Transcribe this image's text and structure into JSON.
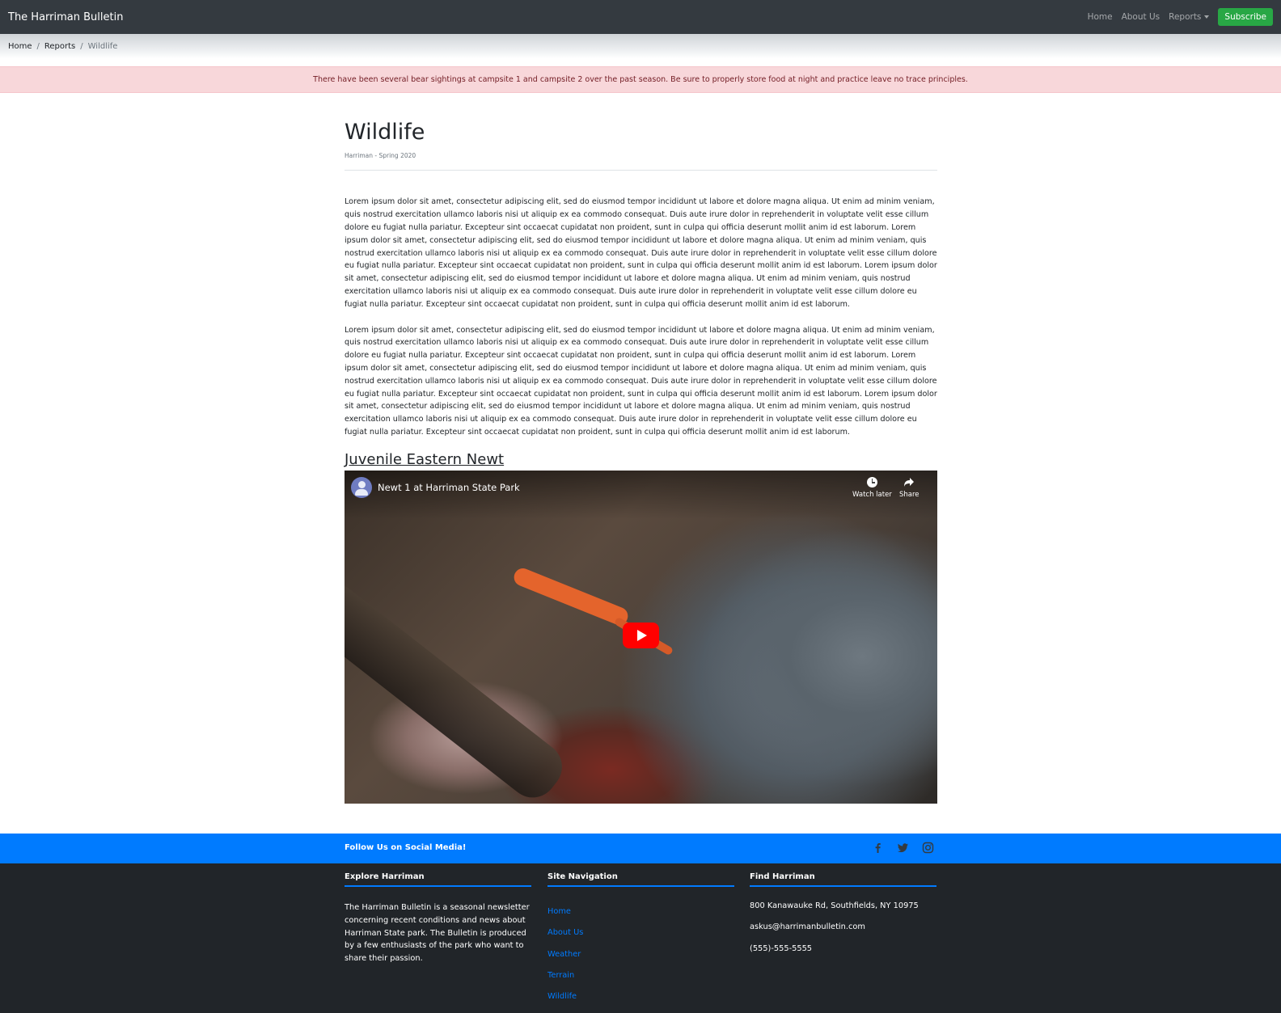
{
  "navbar": {
    "brand": "The Harriman Bulletin",
    "links": {
      "home": "Home",
      "about": "About Us",
      "reports": "Reports"
    },
    "subscribe": "Subscribe"
  },
  "breadcrumb": {
    "items": [
      "Home",
      "Reports"
    ],
    "separator": "/",
    "active": "Wildlife"
  },
  "alert": {
    "text": "There have been several bear sightings at campsite 1 and campsite 2 over the past season. Be sure to properly store food at night and practice leave no trace principles."
  },
  "article": {
    "title": "Wildlife",
    "meta": "Harriman - Spring 2020",
    "paragraphs": [
      "Lorem ipsum dolor sit amet, consectetur adipiscing elit, sed do eiusmod tempor incididunt ut labore et dolore magna aliqua. Ut enim ad minim veniam, quis nostrud exercitation ullamco laboris nisi ut aliquip ex ea commodo consequat. Duis aute irure dolor in reprehenderit in voluptate velit esse cillum dolore eu fugiat nulla pariatur. Excepteur sint occaecat cupidatat non proident, sunt in culpa qui officia deserunt mollit anim id est laborum. Lorem ipsum dolor sit amet, consectetur adipiscing elit, sed do eiusmod tempor incididunt ut labore et dolore magna aliqua. Ut enim ad minim veniam, quis nostrud exercitation ullamco laboris nisi ut aliquip ex ea commodo consequat. Duis aute irure dolor in reprehenderit in voluptate velit esse cillum dolore eu fugiat nulla pariatur. Excepteur sint occaecat cupidatat non proident, sunt in culpa qui officia deserunt mollit anim id est laborum. Lorem ipsum dolor sit amet, consectetur adipiscing elit, sed do eiusmod tempor incididunt ut labore et dolore magna aliqua. Ut enim ad minim veniam, quis nostrud exercitation ullamco laboris nisi ut aliquip ex ea commodo consequat. Duis aute irure dolor in reprehenderit in voluptate velit esse cillum dolore eu fugiat nulla pariatur. Excepteur sint occaecat cupidatat non proident, sunt in culpa qui officia deserunt mollit anim id est laborum.",
      "Lorem ipsum dolor sit amet, consectetur adipiscing elit, sed do eiusmod tempor incididunt ut labore et dolore magna aliqua. Ut enim ad minim veniam, quis nostrud exercitation ullamco laboris nisi ut aliquip ex ea commodo consequat. Duis aute irure dolor in reprehenderit in voluptate velit esse cillum dolore eu fugiat nulla pariatur. Excepteur sint occaecat cupidatat non proident, sunt in culpa qui officia deserunt mollit anim id est laborum. Lorem ipsum dolor sit amet, consectetur adipiscing elit, sed do eiusmod tempor incididunt ut labore et dolore magna aliqua. Ut enim ad minim veniam, quis nostrud exercitation ullamco laboris nisi ut aliquip ex ea commodo consequat. Duis aute irure dolor in reprehenderit in voluptate velit esse cillum dolore eu fugiat nulla pariatur. Excepteur sint occaecat cupidatat non proident, sunt in culpa qui officia deserunt mollit anim id est laborum. Lorem ipsum dolor sit amet, consectetur adipiscing elit, sed do eiusmod tempor incididunt ut labore et dolore magna aliqua. Ut enim ad minim veniam, quis nostrud exercitation ullamco laboris nisi ut aliquip ex ea commodo consequat. Duis aute irure dolor in reprehenderit in voluptate velit esse cillum dolore eu fugiat nulla pariatur. Excepteur sint occaecat cupidatat non proident, sunt in culpa qui officia deserunt mollit anim id est laborum."
    ],
    "section_heading": "Juvenile Eastern Newt",
    "video": {
      "title": "Newt 1 at Harriman State Park",
      "watch_later": "Watch later",
      "share": "Share",
      "play_icon": "play-icon"
    }
  },
  "social": {
    "label": "Follow Us on Social Media!",
    "icons": [
      "facebook-icon",
      "twitter-icon",
      "instagram-icon"
    ]
  },
  "footer": {
    "explore": {
      "heading": "Explore Harriman",
      "text": "The Harriman Bulletin is a seasonal newsletter concerning recent conditions and news about Harriman State park. The Bulletin is produced by a few enthusiasts of the park who want to share their passion."
    },
    "navigation": {
      "heading": "Site Navigation",
      "links": [
        "Home",
        "About Us",
        "Weather",
        "Terrain",
        "Wildlife"
      ]
    },
    "find": {
      "heading": "Find Harriman",
      "address": "800 Kanawauke Rd, Southfields, NY 10975",
      "email": "askus@harrimanbulletin.com",
      "phone": "(555)-555-5555"
    }
  },
  "colors": {
    "navbar": "#343a40",
    "subscribe": "#28a745",
    "alert_bg": "#f8d7da",
    "alert_text": "#721c24",
    "social_bar": "#007bff",
    "footer": "#212529",
    "footer_link": "#007bff"
  }
}
